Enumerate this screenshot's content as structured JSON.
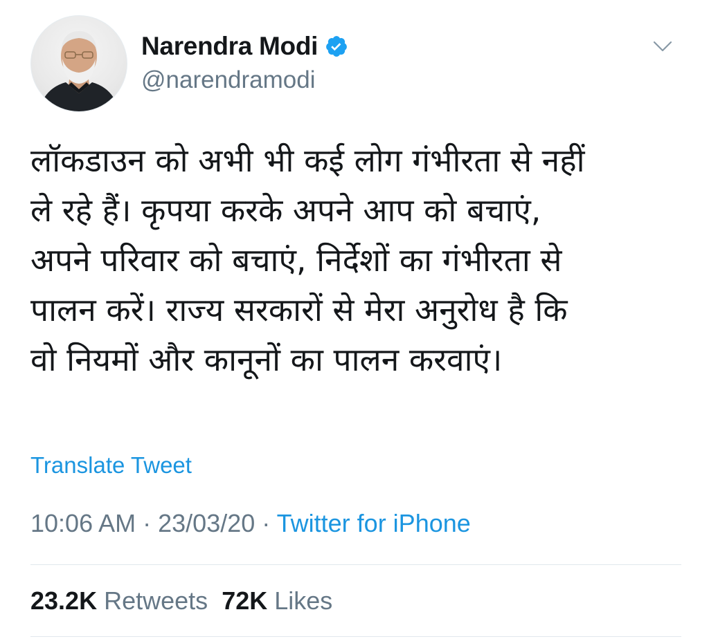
{
  "author": {
    "display_name": "Narendra Modi",
    "handle": "@narendramodi",
    "verified": true,
    "verified_color": "#1da1f2"
  },
  "tweet": {
    "lines": [
      "लॉकडाउन को अभी भी कई लोग गंभीरता से नहीं",
      "ले रहे हैं। कृपया करके अपने आप को बचाएं,",
      "अपने परिवार को बचाएं, निर्देशों का गंभीरता से",
      "पालन करें। राज्य सरकारों से मेरा अनुरोध है कि",
      "वो नियमों और कानूनों का पालन करवाएं।"
    ],
    "translate_label": "Translate Tweet",
    "time": "10:06 AM",
    "separator": "·",
    "date": "23/03/20",
    "source": "Twitter for iPhone"
  },
  "stats": {
    "retweets_count": "23.2K",
    "retweets_label": "Retweets",
    "likes_count": "72K",
    "likes_label": "Likes"
  },
  "colors": {
    "link": "#1b95e0",
    "secondary_text": "#657786",
    "primary_text": "#14171a",
    "divider": "#e1e8ed"
  }
}
